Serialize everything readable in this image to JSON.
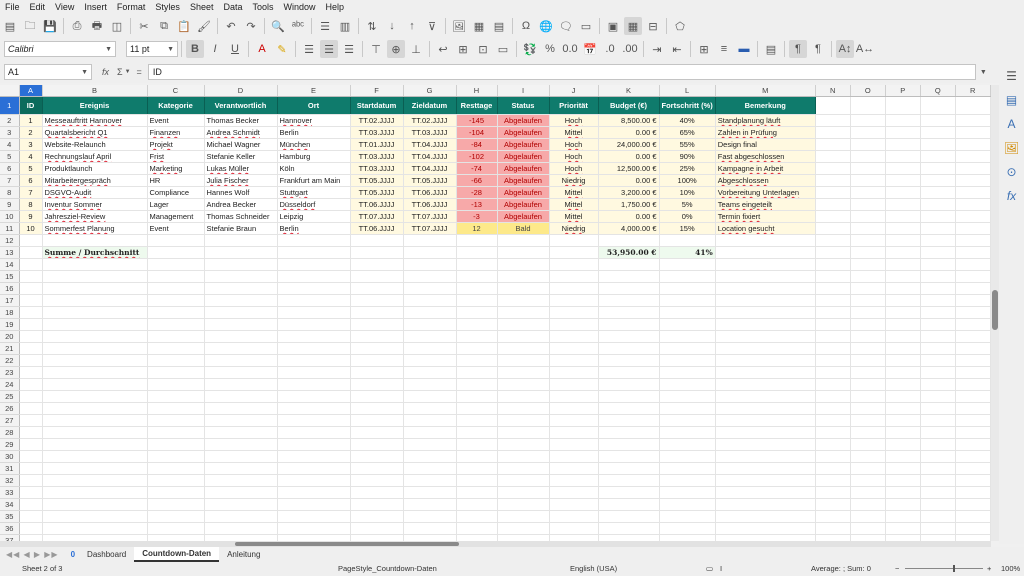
{
  "menu": [
    "File",
    "Edit",
    "View",
    "Insert",
    "Format",
    "Styles",
    "Sheet",
    "Data",
    "Tools",
    "Window",
    "Help"
  ],
  "font": {
    "name": "Calibri",
    "size": "11 pt"
  },
  "formula": {
    "cell_ref": "A1",
    "fx": "fx",
    "sum": "Σ",
    "eq": "=",
    "value": "ID"
  },
  "columns": [
    "A",
    "B",
    "C",
    "D",
    "E",
    "F",
    "G",
    "H",
    "I",
    "J",
    "K",
    "L",
    "M",
    "N",
    "O",
    "P",
    "Q",
    "R"
  ],
  "headers": [
    "ID",
    "Ereignis",
    "Kategorie",
    "Verantwortlich",
    "Ort",
    "Startdatum",
    "Zieldatum",
    "Resttage",
    "Status",
    "Priorität",
    "Budget (€)",
    "Fortschritt (%)",
    "Bemerkung"
  ],
  "rows": [
    [
      "1",
      "Messeauftritt Hannover",
      "Event",
      "Thomas Becker",
      "Hannover",
      "TT.02.JJJJ",
      "TT.02.JJJJ",
      "-145",
      "Abgelaufen",
      "Hoch",
      "8,500.00 €",
      "40%",
      "Standplanung läuft"
    ],
    [
      "2",
      "Quartalsbericht Q1",
      "Finanzen",
      "Andrea Schmidt",
      "Berlin",
      "TT.03.JJJJ",
      "TT.03.JJJJ",
      "-104",
      "Abgelaufen",
      "Mittel",
      "0.00 €",
      "65%",
      "Zahlen in Prüfung"
    ],
    [
      "3",
      "Website-Relaunch",
      "Projekt",
      "Michael Wagner",
      "München",
      "TT.01.JJJJ",
      "TT.04.JJJJ",
      "-84",
      "Abgelaufen",
      "Hoch",
      "24,000.00 €",
      "55%",
      "Design final"
    ],
    [
      "4",
      "Rechnungslauf April",
      "Frist",
      "Stefanie Keller",
      "Hamburg",
      "TT.03.JJJJ",
      "TT.04.JJJJ",
      "-102",
      "Abgelaufen",
      "Hoch",
      "0.00 €",
      "90%",
      "Fast abgeschlossen"
    ],
    [
      "5",
      "Produktlaunch",
      "Marketing",
      "Lukas Müller",
      "Köln",
      "TT.03.JJJJ",
      "TT.04.JJJJ",
      "-74",
      "Abgelaufen",
      "Hoch",
      "12,500.00 €",
      "25%",
      "Kampagne in Arbeit"
    ],
    [
      "6",
      "Mitarbeitergespräch",
      "HR",
      "Julia Fischer",
      "Frankfurt am Main",
      "TT.05.JJJJ",
      "TT.05.JJJJ",
      "-66",
      "Abgelaufen",
      "Niedrig",
      "0.00 €",
      "100%",
      "Abgeschlossen"
    ],
    [
      "7",
      "DSGVO-Audit",
      "Compliance",
      "Hannes Wolf",
      "Stuttgart",
      "TT.05.JJJJ",
      "TT.06.JJJJ",
      "-28",
      "Abgelaufen",
      "Mittel",
      "3,200.00 €",
      "10%",
      "Vorbereitung Unterlagen"
    ],
    [
      "8",
      "Inventur Sommer",
      "Lager",
      "Andrea Becker",
      "Düsseldorf",
      "TT.06.JJJJ",
      "TT.06.JJJJ",
      "-13",
      "Abgelaufen",
      "Mittel",
      "1,750.00 €",
      "5%",
      "Teams eingeteilt"
    ],
    [
      "9",
      "Jahresziel-Review",
      "Management",
      "Thomas Schneider",
      "Leipzig",
      "TT.07.JJJJ",
      "TT.07.JJJJ",
      "-3",
      "Abgelaufen",
      "Mittel",
      "0.00 €",
      "0%",
      "Termin fixiert"
    ],
    [
      "10",
      "Sommerfest Planung",
      "Event",
      "Stefanie Braun",
      "Berlin",
      "TT.06.JJJJ",
      "TT.07.JJJJ",
      "12",
      "Bald",
      "Niedrig",
      "4,000.00 €",
      "15%",
      "Location gesucht"
    ]
  ],
  "summary": {
    "label": "Summe / Durchschnitt",
    "budget": "53,950.00 €",
    "progress": "41%"
  },
  "row_count": 37,
  "tabs": {
    "badge": "0",
    "items": [
      "Dashboard",
      "Countdown-Daten",
      "Anleitung"
    ],
    "active": "Countdown-Daten"
  },
  "status": {
    "sheet": "Sheet 2 of 3",
    "page_style": "PageStyle_Countdown-Daten",
    "language": "English (USA)",
    "calc": "Average: ; Sum: 0",
    "zoom": "100%"
  },
  "colors": {
    "header_bg": "#0f7b6c",
    "expired_bg": "#f7a9a9",
    "soon_bg": "#fde98a",
    "selection": "#2a6fd6"
  }
}
